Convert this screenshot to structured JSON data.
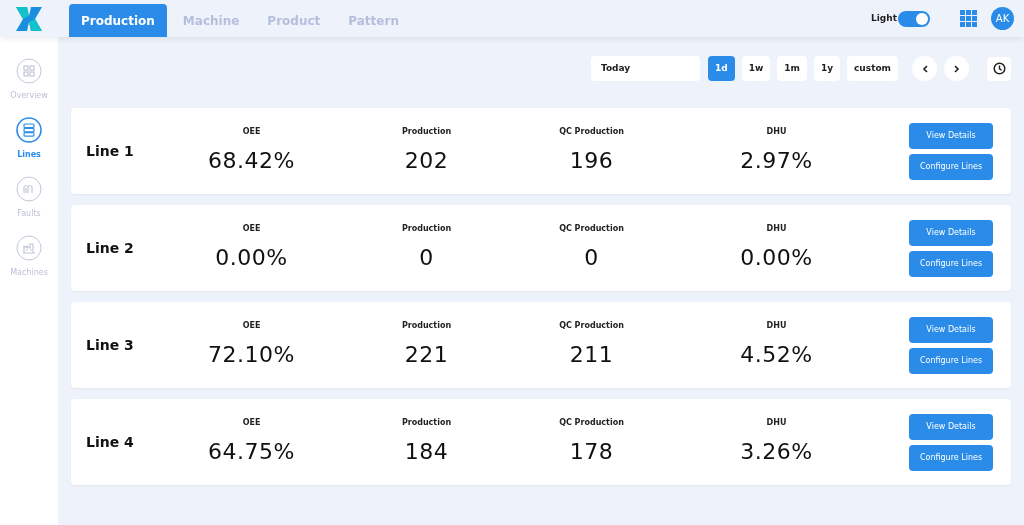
{
  "tabs": [
    {
      "label": "Production",
      "selected": true
    },
    {
      "label": "Machine",
      "selected": false
    },
    {
      "label": "Product",
      "selected": false
    },
    {
      "label": "Pattern",
      "selected": false
    }
  ],
  "theme_toggle": {
    "label": "Light",
    "on": true
  },
  "user": {
    "initials": "AK"
  },
  "sidebar": {
    "items": [
      {
        "label": "Overview",
        "kind": "grid",
        "selected": false
      },
      {
        "label": "Lines",
        "kind": "stack",
        "selected": true
      },
      {
        "label": "Faults",
        "kind": "fault",
        "selected": false
      },
      {
        "label": "Machines",
        "kind": "machine",
        "selected": false
      }
    ]
  },
  "date_field": {
    "value": "Today"
  },
  "ranges": [
    {
      "label": "1d",
      "selected": true
    },
    {
      "label": "1w",
      "selected": false
    },
    {
      "label": "1m",
      "selected": false
    },
    {
      "label": "1y",
      "selected": false
    },
    {
      "label": "custom",
      "selected": false
    }
  ],
  "lines": [
    {
      "name": "Line 1",
      "metrics": [
        {
          "label": "OEE",
          "value": "68.42%"
        },
        {
          "label": "Production",
          "value": "202"
        },
        {
          "label": "QC Production",
          "value": "196"
        },
        {
          "label": "DHU",
          "value": "2.97%"
        }
      ],
      "buttons": [
        "View Details",
        "Configure Lines"
      ]
    },
    {
      "name": "Line 2",
      "metrics": [
        {
          "label": "OEE",
          "value": "0.00%"
        },
        {
          "label": "Production",
          "value": "0"
        },
        {
          "label": "QC Production",
          "value": "0"
        },
        {
          "label": "DHU",
          "value": "0.00%"
        }
      ],
      "buttons": [
        "View Details",
        "Configure Lines"
      ]
    },
    {
      "name": "Line 3",
      "metrics": [
        {
          "label": "OEE",
          "value": "72.10%"
        },
        {
          "label": "Production",
          "value": "221"
        },
        {
          "label": "QC Production",
          "value": "211"
        },
        {
          "label": "DHU",
          "value": "4.52%"
        }
      ],
      "buttons": [
        "View Details",
        "Configure Lines"
      ]
    },
    {
      "name": "Line 4",
      "metrics": [
        {
          "label": "OEE",
          "value": "64.75%"
        },
        {
          "label": "Production",
          "value": "184"
        },
        {
          "label": "QC Production",
          "value": "178"
        },
        {
          "label": "DHU",
          "value": "3.26%"
        }
      ],
      "buttons": [
        "View Details",
        "Configure Lines"
      ]
    }
  ]
}
